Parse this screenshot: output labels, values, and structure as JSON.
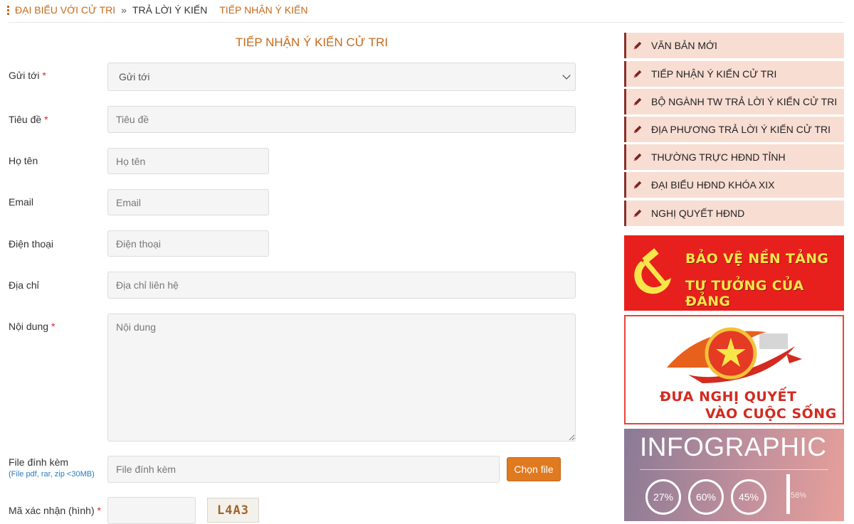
{
  "breadcrumb": {
    "first": "ĐẠI BIỂU VỚI CỬ TRI",
    "separator": "»",
    "second": "TRẢ LỜI Ý KIẾN",
    "third": "TIẾP NHẬN Ý KIẾN"
  },
  "form": {
    "title": "TIẾP NHẬN Ý KIẾN CỬ TRI",
    "required_mark": "*",
    "send_to": {
      "label": "Gửi tới",
      "value": "Gửi tới"
    },
    "subject": {
      "label": "Tiêu đề",
      "placeholder": "Tiêu đề"
    },
    "full_name": {
      "label": "Họ tên",
      "placeholder": "Họ tên"
    },
    "email": {
      "label": "Email",
      "placeholder": "Email"
    },
    "phone": {
      "label": "Điện thoại",
      "placeholder": "Điện thoại"
    },
    "address": {
      "label": "Địa chỉ",
      "placeholder": "Địa chỉ liên hệ"
    },
    "content": {
      "label": "Nội dung",
      "placeholder": "Nội dung"
    },
    "attachment": {
      "label": "File đính kèm",
      "hint": "(File pdf, rar, zip <30MB)",
      "placeholder": "File đính kèm",
      "button": "Chọn file"
    },
    "captcha": {
      "label": "Mã xác nhận (hình)",
      "image_text": "L4A3"
    }
  },
  "sidebar": {
    "items": [
      {
        "label": "VĂN BẢN MỚI"
      },
      {
        "label": "TIẾP NHẬN Ý KIẾN CỬ TRI"
      },
      {
        "label": "BỘ NGÀNH TW TRẢ LỜI Ý KIẾN CỬ TRI"
      },
      {
        "label": "ĐỊA PHƯƠNG TRẢ LỜI Ý KIẾN CỬ TRI"
      },
      {
        "label": "THƯỜNG TRỰC HĐND TỈNH"
      },
      {
        "label": "ĐẠI BIỂU HĐND KHÓA XIX"
      },
      {
        "label": "NGHỊ QUYẾT HĐND"
      }
    ],
    "icon": "pencil-icon"
  },
  "banners": {
    "banner1": {
      "line1": "BẢO VỆ NỀN TẢNG",
      "line2": "TƯ TƯỞNG CỦA ĐẢNG"
    },
    "banner2": {
      "line1": "ĐƯA NGHỊ QUYẾT",
      "line2": "VÀO CUỘC SỐNG"
    },
    "banner3": {
      "title": "INFOGRAPHIC",
      "stats": [
        "27%",
        "60%",
        "45%"
      ],
      "side_value": "58%"
    }
  },
  "colors": {
    "accent": "#c66a1b",
    "required": "#d9262a",
    "button": "#e07a20",
    "sidebar_bg": "#f8ddd3",
    "sidebar_border": "#8a2f2a"
  }
}
